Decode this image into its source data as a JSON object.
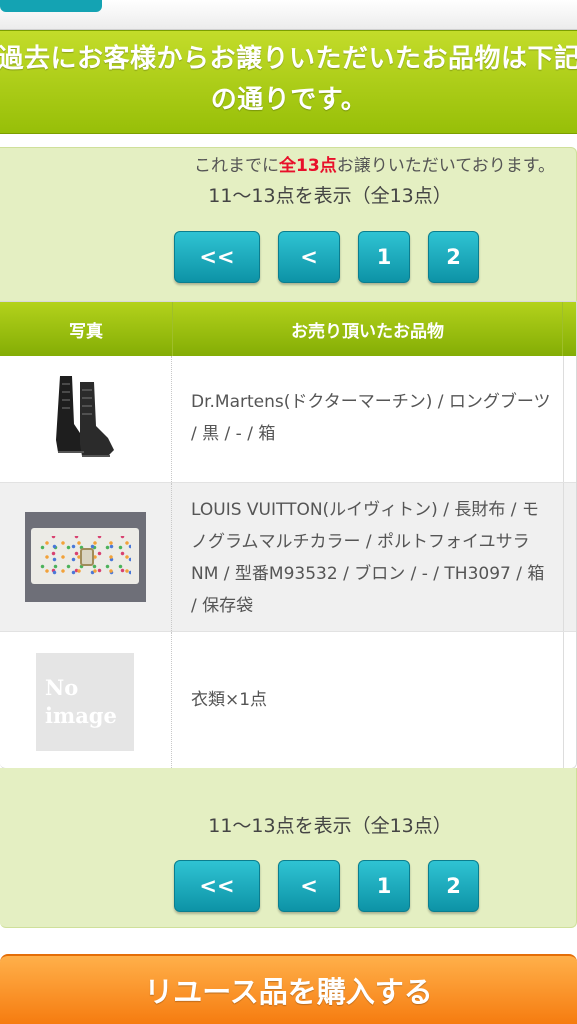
{
  "header": {
    "banner_text": "過去にお客様からお譲りいただいたお品物は下記の通りです。"
  },
  "summary": {
    "prefix": "これまでに",
    "count": "全13点",
    "suffix": "お譲りいただいております。",
    "range_top": "11〜13点を表示（全13点）",
    "range_bottom": "11〜13点を表示（全13点）"
  },
  "pager": {
    "first": "<<",
    "prev": "<",
    "page1": "1",
    "page2": "2"
  },
  "table": {
    "headers": [
      "写真",
      "お売り頂いたお品物"
    ],
    "rows": [
      {
        "image": "boots-photo",
        "description": "Dr.Martens(ドクターマーチン) / ロングブーツ / 黒 / - / 箱"
      },
      {
        "image": "wallet-photo",
        "description": "LOUIS VUITTON(ルイヴィトン) / 長財布 / モノグラムマルチカラー / ポルトフォイユサラNM / 型番M93532 / ブロン / - / TH3097 / 箱 / 保存袋"
      },
      {
        "image": "no-image",
        "description": "衣類×1点",
        "image_text_1": "No",
        "image_text_2": "image"
      }
    ]
  },
  "cta": {
    "buy_label": "リユース品を購入する"
  },
  "colors": {
    "accent_green": "#97bf08",
    "button_teal": "#14a3b3",
    "count_red": "#e8102b",
    "cta_orange": "#f67c10"
  }
}
